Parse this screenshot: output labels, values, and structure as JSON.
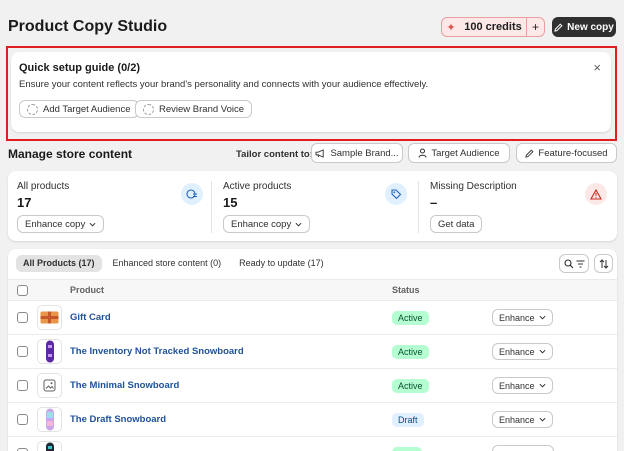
{
  "header": {
    "title": "Product Copy Studio",
    "credits_label": "100 credits",
    "credits_plus": "+",
    "new_copy_label": "New copy"
  },
  "setup_guide": {
    "title": "Quick setup guide (0/2)",
    "description": "Ensure your content reflects your brand's personality and connects with your audience effectively.",
    "close_symbol": "×",
    "steps": [
      "Add Target Audience",
      "Review Brand Voice"
    ]
  },
  "manage": {
    "title": "Manage store content",
    "tailor_label": "Tailor content to:",
    "tailor_options": [
      "Sample Brand...",
      "Target Audience",
      "Feature-focused"
    ]
  },
  "stats": [
    {
      "label": "All products",
      "value": "17",
      "action": "Enhance copy",
      "icon": "sparkle-list-icon"
    },
    {
      "label": "Active products",
      "value": "15",
      "action": "Enhance copy",
      "icon": "tag-icon"
    },
    {
      "label": "Missing Description",
      "value": "–",
      "action": "Get data",
      "icon": "alert-triangle-icon"
    }
  ],
  "table": {
    "tabs": [
      "All Products (17)",
      "Enhanced store content (0)",
      "Ready to update (17)"
    ],
    "columns": {
      "product": "Product",
      "status": "Status"
    },
    "rows": [
      {
        "name": "Gift Card",
        "status": "Active",
        "action": "Enhance",
        "thumb": "gift-card-thumbnail"
      },
      {
        "name": "The Inventory Not Tracked Snowboard",
        "status": "Active",
        "action": "Enhance",
        "thumb": "purple-snowboard-thumbnail"
      },
      {
        "name": "The Minimal Snowboard",
        "status": "Active",
        "action": "Enhance",
        "thumb": "placeholder-image-thumbnail"
      },
      {
        "name": "The Draft Snowboard",
        "status": "Draft",
        "action": "Enhance",
        "thumb": "pastel-snowboard-thumbnail"
      },
      {
        "name": "",
        "status": "",
        "action": "",
        "thumb": "dark-snowboard-thumbnail"
      }
    ]
  },
  "colors": {
    "accent_red": "#e01e1e",
    "active_badge": "#b4fed2",
    "draft_badge": "#e0f0ff",
    "link_blue": "#1f5199",
    "dark_button": "#303030"
  }
}
